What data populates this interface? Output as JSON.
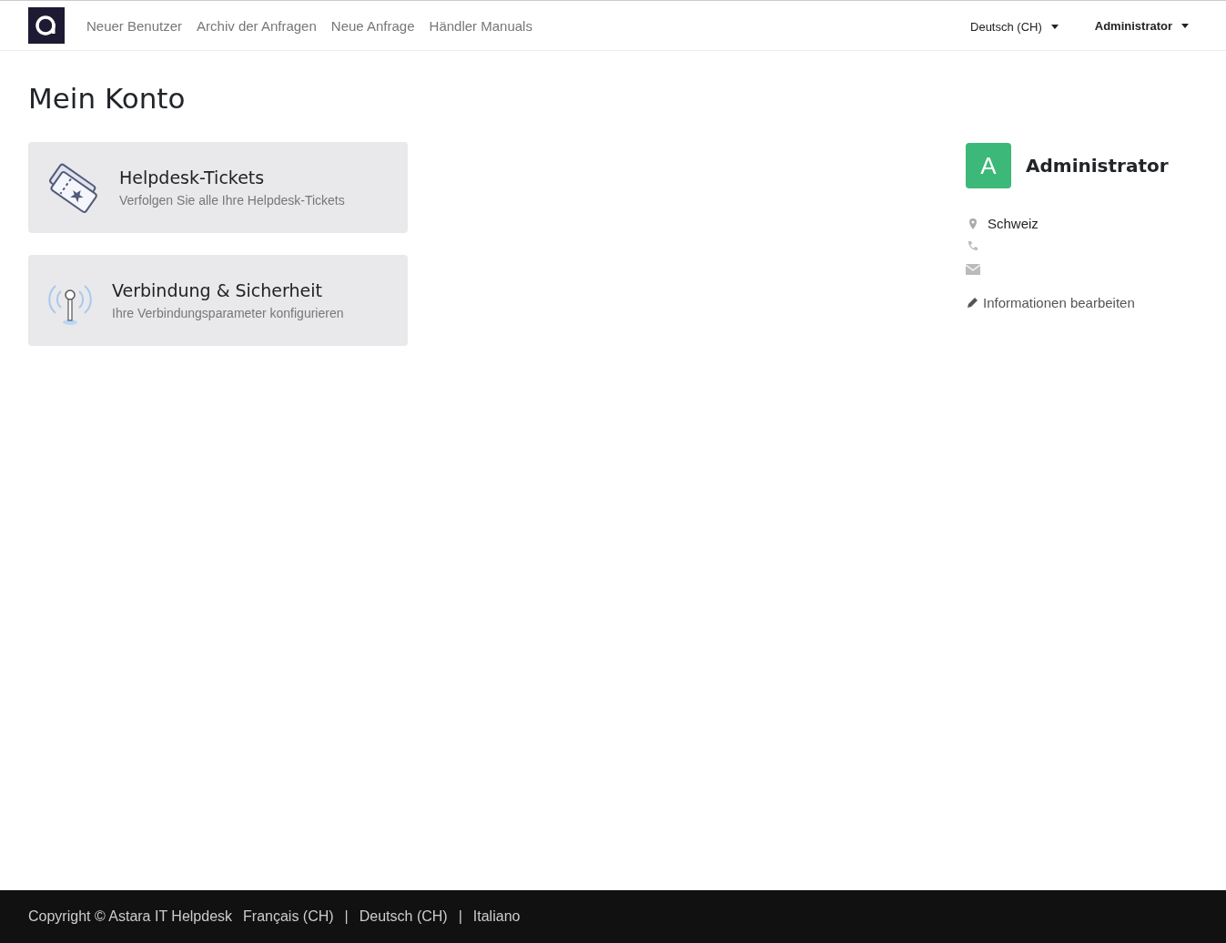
{
  "navbar": {
    "links": [
      "Neuer Benutzer",
      "Archiv der Anfragen",
      "Neue Anfrage",
      "Händler Manuals"
    ],
    "language_menu": "Deutsch (CH)",
    "user_menu": "Administrator"
  },
  "page_title": "Mein Konto",
  "cards": [
    {
      "kind": "tickets",
      "title": "Helpdesk-Tickets",
      "subtitle": "Verfolgen Sie alle Ihre Helpdesk-Tickets"
    },
    {
      "kind": "connection",
      "title": "Verbindung & Sicherheit",
      "subtitle": "Ihre Verbindungsparameter konfigurieren"
    }
  ],
  "profile": {
    "avatar_letter": "A",
    "name": "Administrator",
    "details": [
      {
        "kind": "location",
        "text": "Schweiz"
      },
      {
        "kind": "phone"
      },
      {
        "kind": "email"
      }
    ],
    "edit_link": "Informationen bearbeiten"
  },
  "footer": {
    "copyright": "Copyright © Astara IT Helpdesk",
    "languages": [
      "Français (CH)",
      "Deutsch (CH)",
      "Italiano"
    ],
    "separators": [
      "|",
      "|"
    ]
  }
}
